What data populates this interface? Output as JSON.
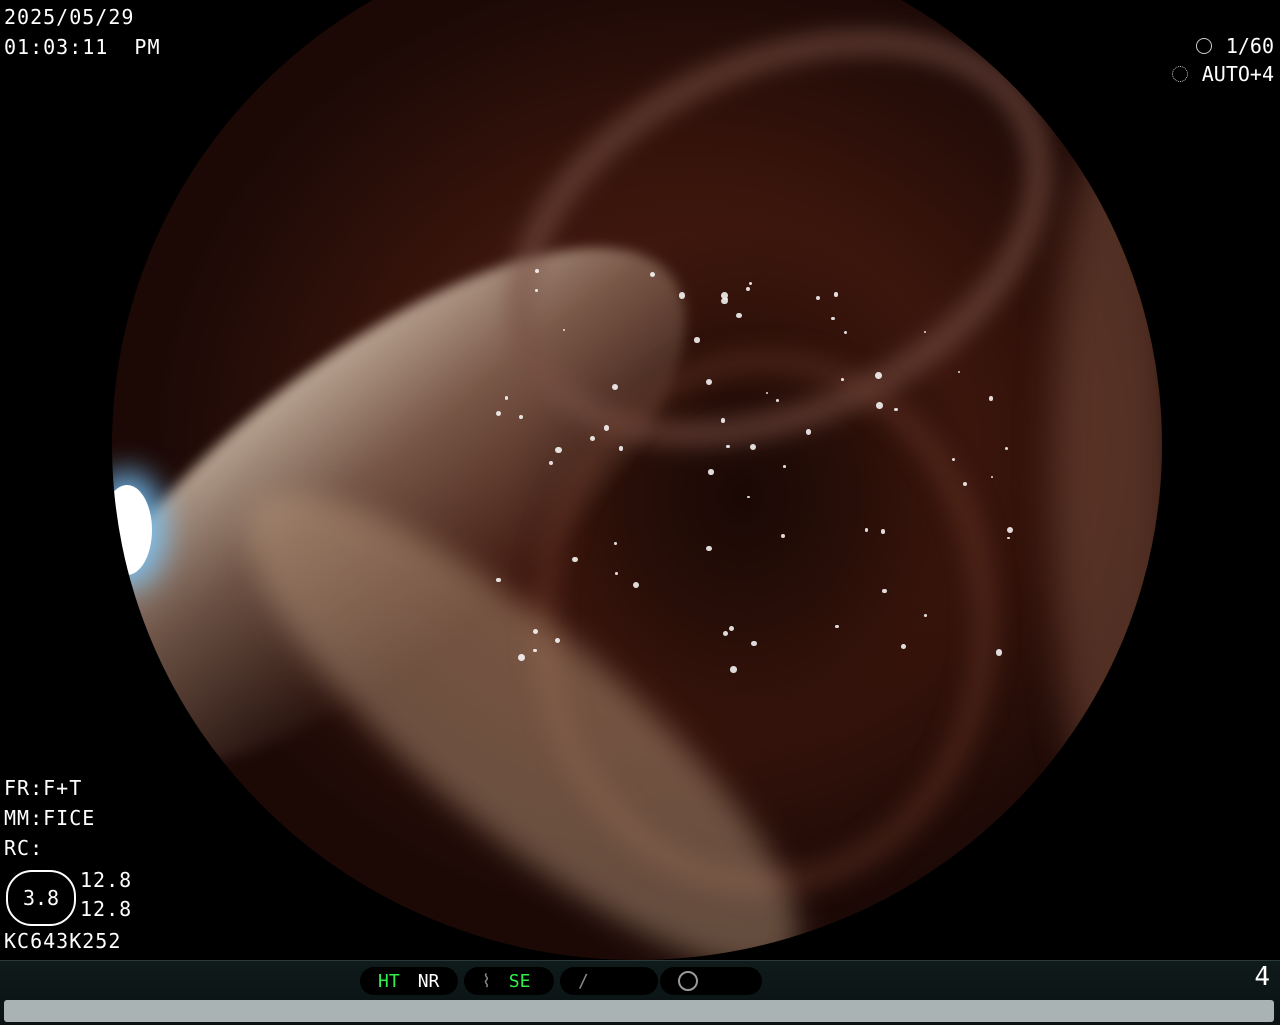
{
  "datetime": {
    "date": "2025/05/29",
    "time": "01:03:11  PM"
  },
  "exposure": {
    "shutter": "1/60",
    "auto": "AUTO+4",
    "shutter_icon": "aperture-icon",
    "auto_icon": "gear-icon"
  },
  "settings": {
    "fr": "FR:F+T",
    "mm": "MM:FICE",
    "rc": "RC:",
    "badge_value": "3.8",
    "val1": "12.8",
    "val2": "12.8",
    "serial": "KC643K252"
  },
  "status_bar": {
    "ht": "HT",
    "nr": "NR",
    "se": "SE",
    "se_icon": "wave-icon",
    "slash_icon": "slash-icon",
    "circle_icon": "circle-icon",
    "page": "4"
  },
  "colors": {
    "active_green": "#2ff04a",
    "bar_bg": "#0f1a1a"
  }
}
